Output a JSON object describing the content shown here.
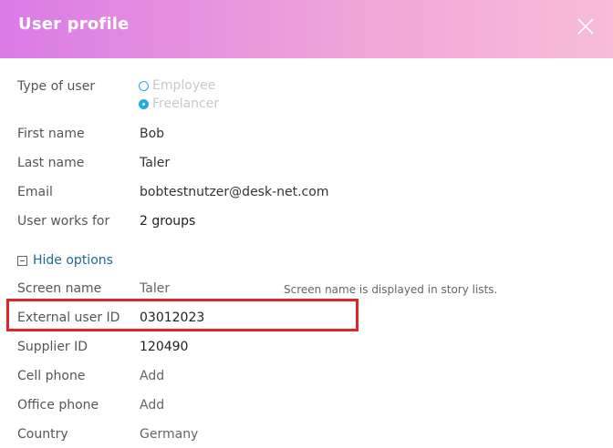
{
  "header": {
    "title": "User profile",
    "close_icon": "close-icon",
    "gradient": [
      "#d97be6",
      "#f7bcd8"
    ]
  },
  "type_of_user": {
    "label": "Type of user",
    "options": [
      "Employee",
      "Freelancer"
    ],
    "selected": "Freelancer"
  },
  "fields": {
    "first_name": {
      "label": "First name",
      "value": "Bob"
    },
    "last_name": {
      "label": "Last name",
      "value": "Taler"
    },
    "email": {
      "label": "Email",
      "value": "bobtestnutzer@desk-net.com"
    },
    "works_for": {
      "label": "User works for",
      "value": "2 groups"
    }
  },
  "options_toggle": {
    "label": "Hide options"
  },
  "options": {
    "screen_name": {
      "label": "Screen name",
      "value": "Taler",
      "hint": "Screen name is displayed in story lists."
    },
    "external_user_id": {
      "label": "External user ID",
      "value": "03012023"
    },
    "supplier_id": {
      "label": "Supplier ID",
      "value": "120490"
    },
    "cell_phone": {
      "label": "Cell phone",
      "value": "Add"
    },
    "office_phone": {
      "label": "Office phone",
      "value": "Add"
    },
    "country": {
      "label": "Country",
      "value": "Germany"
    }
  },
  "colors": {
    "accent": "#27a8e0",
    "link": "#1d6a93",
    "highlight": "#e0242c"
  }
}
